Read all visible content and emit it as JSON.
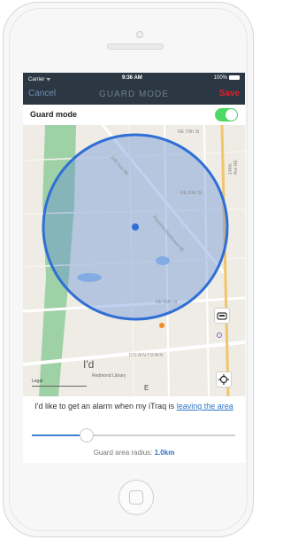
{
  "status_bar": {
    "carrier": "Carrier ᯤ",
    "time": "9:36 AM",
    "battery": "100%"
  },
  "nav": {
    "cancel_label": "Cancel",
    "title": "GUARD MODE",
    "save_label": "Save"
  },
  "guard_toggle": {
    "label": "Guard mode",
    "enabled": true
  },
  "map": {
    "labels": [
      "12th Ave NE",
      "Ravenna Boulevard NE",
      "NE 65th St",
      "NE 60th St",
      "DOWNTOWN",
      "Redmond Library",
      "I'd",
      "Legal",
      "E",
      "NE 70th St",
      "148th Ave NE"
    ],
    "guard_area": {
      "radius_km": 1.0,
      "fill_color": "rgba(91,136,215,0.38)",
      "stroke_color": "#2f6fd6"
    }
  },
  "alarm": {
    "prefix": "I'd like to get an alarm when my iTraq is",
    "link": "leaving the area"
  },
  "slider": {
    "value_fraction": 0.27
  },
  "radius": {
    "label": "Guard area radius:",
    "value": "1.0km"
  },
  "colors": {
    "accent": "#2f74c9",
    "nav_bg": "#2b3742",
    "toggle_on": "#4cd964",
    "save": "#e0212a"
  }
}
